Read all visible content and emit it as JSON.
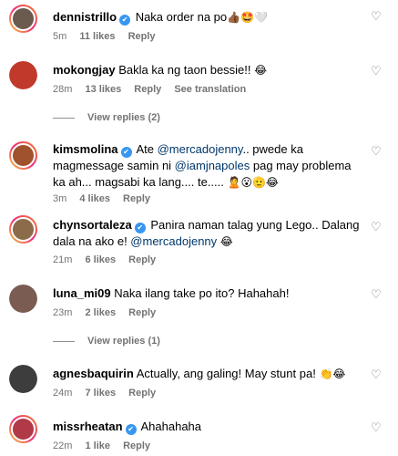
{
  "comments": [
    {
      "username": "dennistrillo",
      "verified": true,
      "text": "Naka order na po",
      "emojis": "👍🏾🤩🤍",
      "time": "5m",
      "likes": "11 likes",
      "reply": "Reply",
      "avatar_color": "#6b5a4e"
    },
    {
      "username": "mokongjay",
      "verified": false,
      "text": "Bakla ka ng taon bessie!!",
      "emojis": "😂",
      "time": "28m",
      "likes": "13 likes",
      "reply": "Reply",
      "see_translation": "See translation",
      "avatar_color": "#c0392b",
      "view_replies": "View replies (2)"
    },
    {
      "username": "kimsmolina",
      "verified": true,
      "text_1": "Ate ",
      "mention_1": "@mercadojenny",
      "text_2": ".. pwede ka magmessage samin ni ",
      "mention_2": "@iamjnapoles",
      "text_3": " pag may problema ka ah... magsabi ka lang.... te.....",
      "emojis": "🙎😮🫡😂",
      "time": "3m",
      "likes": "4 likes",
      "reply": "Reply",
      "avatar_color": "#a0522d"
    },
    {
      "username": "chynsortaleza",
      "verified": true,
      "text_1": "Panira naman talag yung Lego.. Dalang dala na ako e! ",
      "mention_1": "@mercadojenny",
      "emojis": "😂",
      "time": "21m",
      "likes": "6 likes",
      "reply": "Reply",
      "avatar_color": "#8b6b4a"
    },
    {
      "username": "luna_mi09",
      "verified": false,
      "text": "Naka ilang take po ito? Hahahah!",
      "time": "23m",
      "likes": "2 likes",
      "reply": "Reply",
      "avatar_color": "#7a5c52",
      "view_replies": "View replies (1)"
    },
    {
      "username": "agnesbaquirin",
      "verified": false,
      "text": "Actually, ang galing! May stunt pa!",
      "emojis": "👏😂",
      "time": "24m",
      "likes": "7 likes",
      "reply": "Reply",
      "avatar_color": "#3d3d3d"
    },
    {
      "username": "missrheatan",
      "verified": true,
      "text": "Ahahahaha",
      "time": "22m",
      "likes": "1 like",
      "reply": "Reply",
      "avatar_color": "#b03a48"
    }
  ],
  "icons": {
    "verified": "✔",
    "heart": "♡"
  },
  "colors": {
    "meta": "#737373",
    "mention": "#00376b",
    "verified": "#3797f0"
  }
}
